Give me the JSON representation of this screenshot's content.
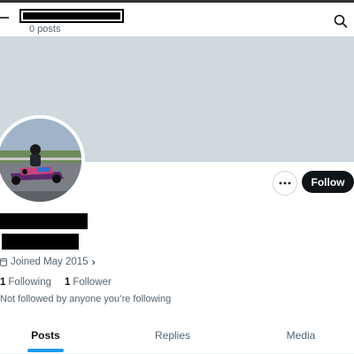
{
  "header": {
    "title": "",
    "post_count": "0 posts",
    "icons": {
      "back": "arrow-left-icon",
      "search": "search-icon"
    }
  },
  "profile": {
    "name": "",
    "handle": "",
    "joined": "Joined May 2015",
    "following_count": "1",
    "following_label": "Following",
    "follower_count": "1",
    "follower_label": "Follower",
    "followed_by": "Not followed by anyone you’re following"
  },
  "actions": {
    "follow_label": "Follow",
    "more_icon": "more-horizontal-icon"
  },
  "tabs": [
    {
      "label": "Posts",
      "active": true
    },
    {
      "label": "Replies",
      "active": false
    },
    {
      "label": "Media",
      "active": false
    }
  ],
  "colors": {
    "banner": "#cfd9de",
    "follow_bg": "#0f1419",
    "accent": "#1d9bf0",
    "secondary_text": "#536471"
  }
}
